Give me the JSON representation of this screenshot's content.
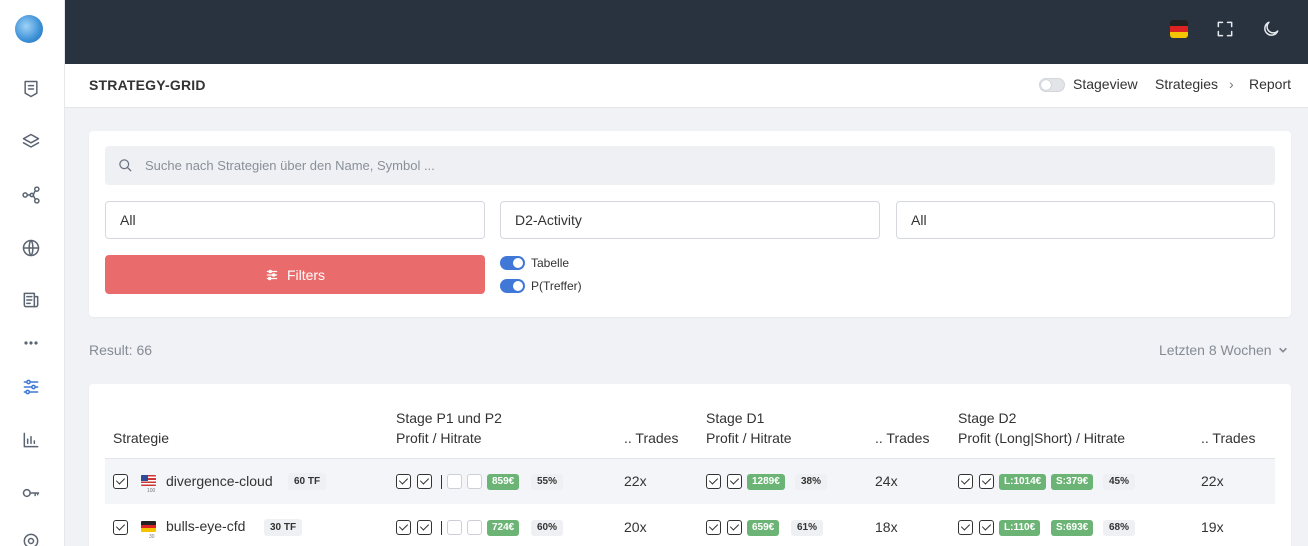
{
  "colors": {
    "topbar": "#28333f",
    "accent": "#3f78d6",
    "filters_button": "#ea6b6b",
    "profit_badge": "#6cb476"
  },
  "sidebar": {
    "icons": [
      "logo-icon",
      "list-icon",
      "layers-icon",
      "share-nodes-icon",
      "globe-icon",
      "news-icon",
      "more-icon",
      "sliders-icon",
      "chart-icon",
      "key-icon",
      "settings-icon"
    ],
    "active": "sliders-icon"
  },
  "topbar": {
    "icons": [
      "flag-de-icon",
      "fullscreen-icon",
      "moon-icon"
    ]
  },
  "header": {
    "title": "STRATEGY-GRID",
    "stageview_label": "Stageview",
    "breadcrumb": [
      "Strategies",
      "Report"
    ]
  },
  "filters": {
    "search_placeholder": "Suche nach Strategien über den Name, Symbol ...",
    "select_1": "All",
    "select_2": "D2-Activity",
    "select_3": "All",
    "button_label": "Filters",
    "switch_1": "Tabelle",
    "switch_2": "P(Treffer)"
  },
  "result_text": "Result: 66",
  "period_label": "Letzten 8 Wochen",
  "table": {
    "headers": {
      "strategy": "Strategie",
      "stage_p_top": "Stage P1 und P2",
      "stage_p_bottom": "Profit / Hitrate",
      "trades_1": ".. Trades",
      "stage_d1_top": "Stage D1",
      "stage_d1_bottom": "Profit / Hitrate",
      "trades_2": ".. Trades",
      "stage_d2_top": "Stage D2",
      "stage_d2_bottom": "Profit (Long|Short) / Hitrate",
      "trades_3": ".. Trades"
    },
    "rows": [
      {
        "name": "divergence-cloud",
        "flag": "us",
        "flag_sub": "100",
        "tf": "60 TF",
        "p_profit": "859€",
        "p_hit": "55%",
        "p_trades": "22x",
        "d1_profit": "1289€",
        "d1_hit": "38%",
        "d1_trades": "24x",
        "d2_long": "L:1014€",
        "d2_short": "S:379€",
        "d2_hit": "45%",
        "d2_trades": "22x"
      },
      {
        "name": "bulls-eye-cfd",
        "flag": "de",
        "flag_sub": "30",
        "tf": "30 TF",
        "p_profit": "724€",
        "p_hit": "60%",
        "p_trades": "20x",
        "d1_profit": "659€",
        "d1_hit": "61%",
        "d1_trades": "18x",
        "d2_long": "L:110€",
        "d2_short": "S:693€",
        "d2_hit": "68%",
        "d2_trades": "19x"
      }
    ]
  }
}
